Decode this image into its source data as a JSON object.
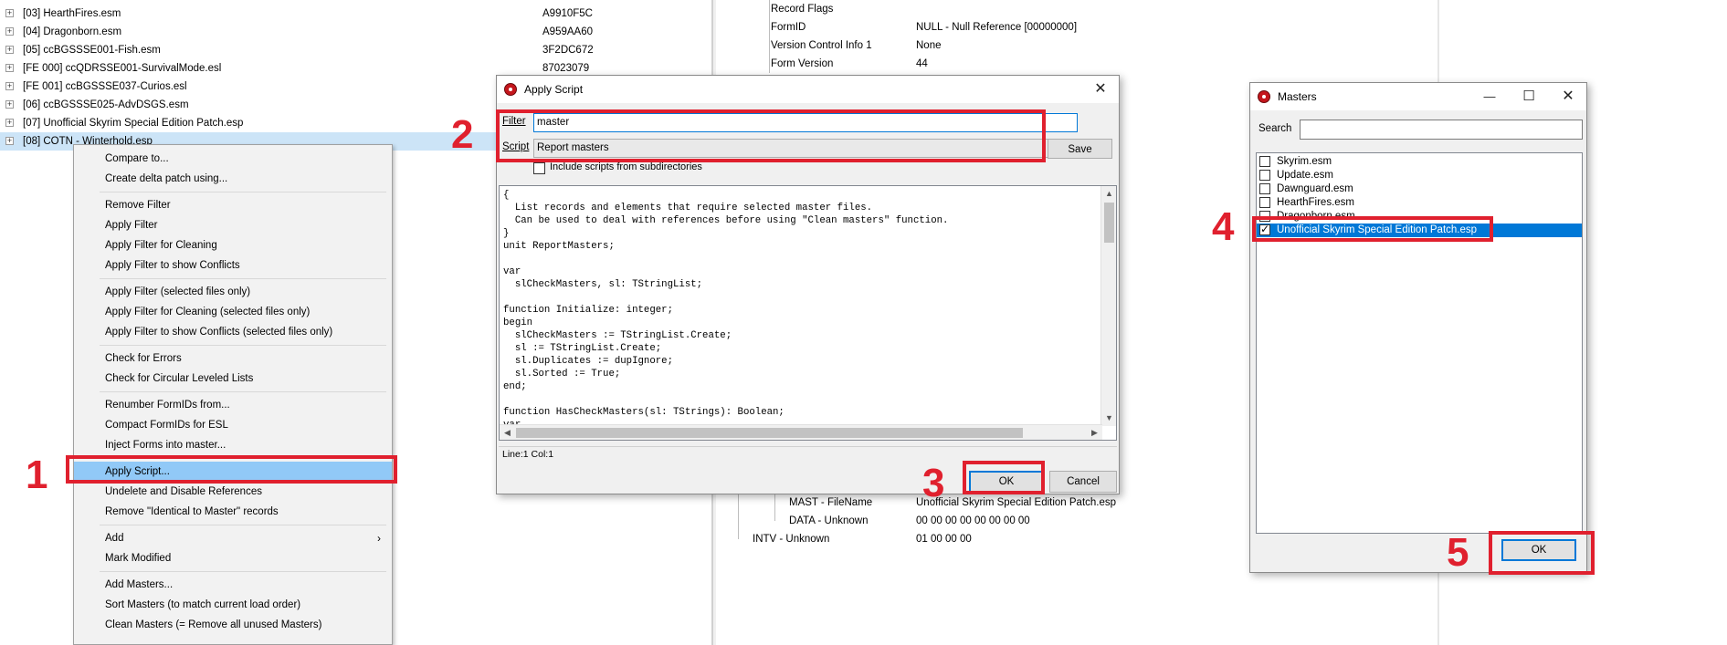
{
  "tree": {
    "rows": [
      {
        "name": "[03] HearthFires.esm",
        "hash": "A9910F5C"
      },
      {
        "name": "[04] Dragonborn.esm",
        "hash": "A959AA60"
      },
      {
        "name": "[05] ccBGSSSE001-Fish.esm",
        "hash": "3F2DC672"
      },
      {
        "name": "[FE 000] ccQDRSSE001-SurvivalMode.esl",
        "hash": "87023079"
      },
      {
        "name": "[FE 001] ccBGSSSE037-Curios.esl",
        "hash": ""
      },
      {
        "name": "[06] ccBGSSSE025-AdvDSGS.esm",
        "hash": ""
      },
      {
        "name": "[07] Unofficial Skyrim Special Edition Patch.esp",
        "hash": ""
      },
      {
        "name": "[08] COTN - Winterhold.esp",
        "hash": ""
      }
    ],
    "expander_glyph": "+"
  },
  "context_menu": {
    "groups": [
      [
        "Compare to...",
        "Create delta patch using..."
      ],
      [
        "Remove Filter",
        "Apply Filter",
        "Apply Filter for Cleaning",
        "Apply Filter to show Conflicts"
      ],
      [
        "Apply Filter (selected files only)",
        "Apply Filter for Cleaning (selected files only)",
        "Apply Filter to show Conflicts (selected files only)"
      ],
      [
        "Check for Errors",
        "Check for Circular Leveled Lists"
      ],
      [
        "Renumber FormIDs from...",
        "Compact FormIDs for ESL",
        "Inject Forms into master..."
      ],
      [
        "Apply Script...",
        "Undelete and Disable References",
        "Remove \"Identical to Master\" records"
      ],
      [
        "Add",
        "Mark Modified"
      ],
      [
        "Add Masters...",
        "Sort Masters (to match current load order)",
        "Clean Masters (= Remove all unused Masters)"
      ]
    ],
    "highlighted": "Apply Script...",
    "submenu_arrow": "›"
  },
  "grid": {
    "top_rows": [
      {
        "label": "Record Flags",
        "value": ""
      },
      {
        "label": "FormID",
        "value": "NULL - Null Reference [00000000]"
      },
      {
        "label": "Version Control Info 1",
        "value": "None"
      },
      {
        "label": "Form Version",
        "value": "44"
      }
    ],
    "bottom_rows": [
      {
        "label": "MAST - FileName",
        "value": "Unofficial Skyrim Special Edition Patch.esp"
      },
      {
        "label": "DATA - Unknown",
        "value": "00 00 00 00 00 00 00 00"
      },
      {
        "label": "INTV - Unknown",
        "value": "01 00 00 00"
      }
    ]
  },
  "apply_script": {
    "title": "Apply Script",
    "close_glyph": "✕",
    "filter_label": "Filter",
    "filter_value": "master",
    "script_label": "Script",
    "script_value": "Report masters",
    "combo_arrow": "⌵",
    "save_label": "Save",
    "include_sub_label": "Include scripts from subdirectories",
    "code": "{\n  List records and elements that require selected master files.\n  Can be used to deal with references before using \"Clean masters\" function.\n}\nunit ReportMasters;\n\nvar\n  slCheckMasters, sl: TStringList;\n\nfunction Initialize: integer;\nbegin\n  slCheckMasters := TStringList.Create;\n  sl := TStringList.Create;\n  sl.Duplicates := dupIgnore;\n  sl.Sorted := True;\nend;\n\nfunction HasCheckMasters(sl: TStrings): Boolean;\nvar",
    "status": "Line:1 Col:1",
    "ok_label": "OK",
    "cancel_label": "Cancel",
    "scroll_up": "▲",
    "scroll_down": "▼",
    "scroll_left": "◀",
    "scroll_right": "▶"
  },
  "masters": {
    "title": "Masters",
    "minimize_glyph": "—",
    "maximize_glyph": "☐",
    "close_glyph": "✕",
    "search_label": "Search",
    "search_value": "",
    "items": [
      {
        "label": "Skyrim.esm",
        "checked": false
      },
      {
        "label": "Update.esm",
        "checked": false
      },
      {
        "label": "Dawnguard.esm",
        "checked": false
      },
      {
        "label": "HearthFires.esm",
        "checked": false
      },
      {
        "label": "Dragonborn.esm",
        "checked": false
      },
      {
        "label": "Unofficial Skyrim Special Edition Patch.esp",
        "checked": true
      }
    ],
    "ok_label": "OK"
  },
  "annotations": {
    "numbers": [
      "1",
      "2",
      "3",
      "4",
      "5"
    ],
    "color": "#e0202e"
  },
  "colors": {
    "selection_light": "#cce4f7",
    "menu_highlight": "#91c9f7",
    "list_selection": "#0078d7",
    "app_icon": "#c4161c"
  }
}
